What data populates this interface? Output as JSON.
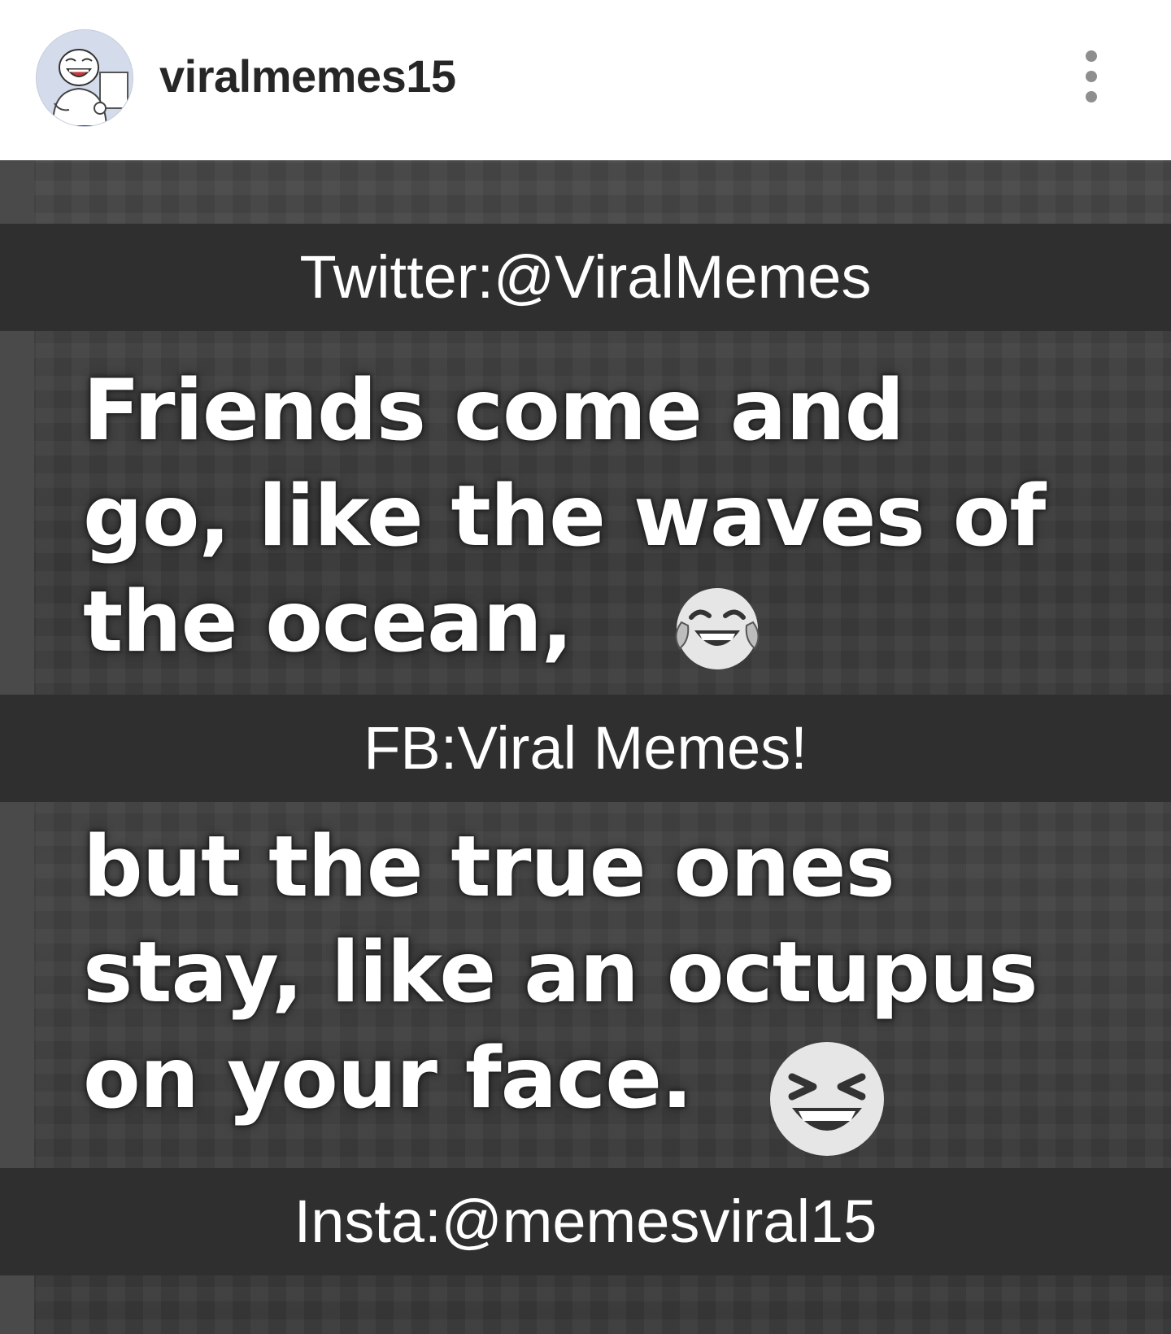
{
  "header": {
    "username": "viralmemes15",
    "avatar_icon": "laughing-meme-face-avatar",
    "more_icon": "more-options-icon"
  },
  "meme": {
    "watermark_top": "Twitter:@ViralMemes",
    "quote_part1": [
      "Friends come and",
      "go, like the waves of",
      "the ocean,"
    ],
    "watermark_middle": "FB:Viral Memes!",
    "quote_part2": [
      "but the true ones",
      "stay, like an octupus",
      "on your face."
    ],
    "watermark_bottom": "Insta:@memesviral15",
    "emoji_1": "tears-of-joy-emoji",
    "emoji_2": "grinning-squinting-emoji"
  },
  "colors": {
    "band_background": "#2f2f2f",
    "image_background": "#3f3f3f",
    "username_text": "#262626",
    "more_dots": "#8e8e8e"
  }
}
